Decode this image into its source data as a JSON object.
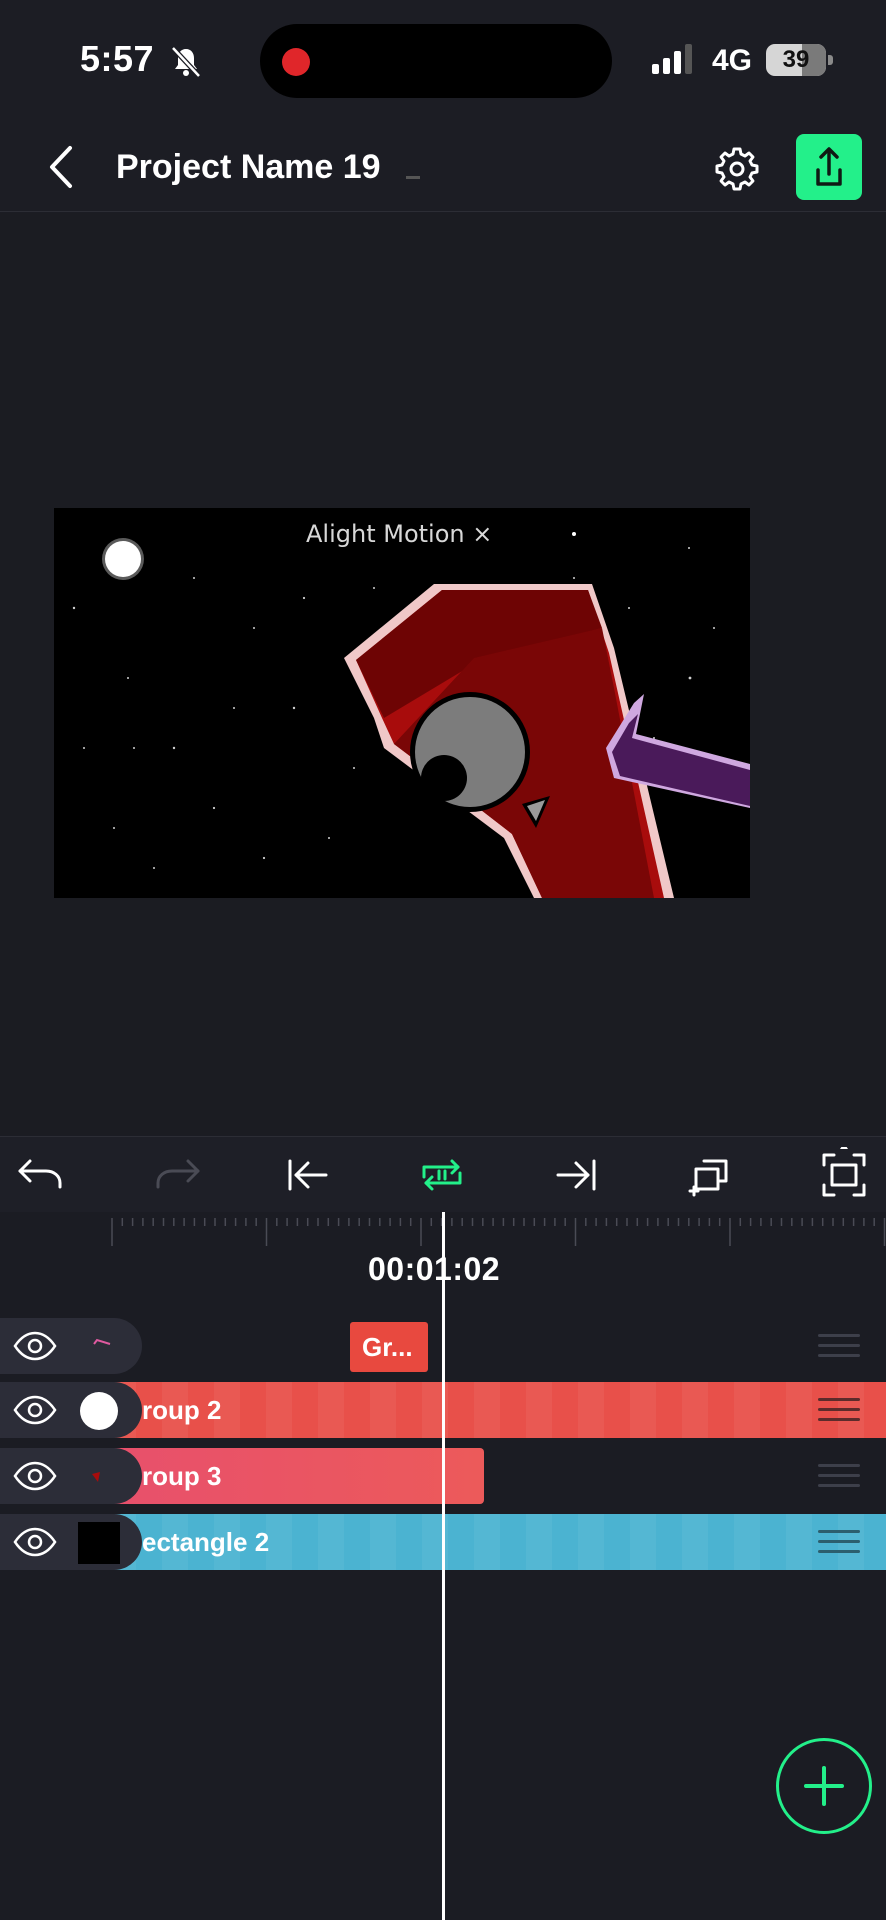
{
  "status_bar": {
    "time": "5:57",
    "network": "4G",
    "battery": "39"
  },
  "header": {
    "title": "Project Name 19"
  },
  "preview": {
    "watermark": "Alight Motion ×"
  },
  "timeline": {
    "timecode": "00:01:02",
    "layers": [
      {
        "label": "Gr...",
        "color": "#e8493f"
      },
      {
        "label": "roup 2",
        "color": "#e8504a"
      },
      {
        "label": "roup 3",
        "color": "#e8506c"
      },
      {
        "label": "ectangle 2",
        "color": "#4bb3d1"
      }
    ]
  },
  "colors": {
    "accent": "#23f08a",
    "background": "#1b1c23",
    "panel": "#2c2d38"
  },
  "icons": [
    "bell-slash-icon",
    "back-icon",
    "settings-gear-icon",
    "export-share-icon",
    "undo-icon",
    "redo-icon",
    "go-to-start-icon",
    "loop-icon",
    "go-to-end-icon",
    "duplicate-icon",
    "fit-screen-icon",
    "eye-icon",
    "add-icon"
  ]
}
